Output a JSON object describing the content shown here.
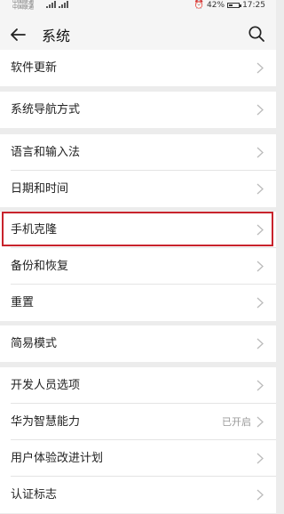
{
  "status_bar": {
    "carrier_1": "中国联通",
    "carrier_2": "中国联通",
    "network": "4G",
    "battery_percent": "42%",
    "battery_level": 0.42,
    "time": "17:25"
  },
  "app_bar": {
    "back_icon": "arrow-left-icon",
    "title": "系统",
    "search_icon": "search-icon"
  },
  "groups": [
    {
      "items": [
        {
          "label": "软件更新"
        }
      ]
    },
    {
      "items": [
        {
          "label": "系统导航方式"
        }
      ]
    },
    {
      "items": [
        {
          "label": "语言和输入法"
        },
        {
          "label": "日期和时间"
        }
      ]
    },
    {
      "items": [
        {
          "label": "手机克隆",
          "highlighted": true
        },
        {
          "label": "备份和恢复"
        },
        {
          "label": "重置"
        }
      ]
    },
    {
      "items": [
        {
          "label": "简易模式"
        }
      ]
    },
    {
      "items": [
        {
          "label": "开发人员选项"
        },
        {
          "label": "华为智慧能力",
          "value": "已开启"
        },
        {
          "label": "用户体验改进计划"
        },
        {
          "label": "认证标志"
        }
      ]
    }
  ],
  "colors": {
    "highlight_border": "#c8232c",
    "background": "#ececec",
    "row_background": "#ffffff"
  }
}
